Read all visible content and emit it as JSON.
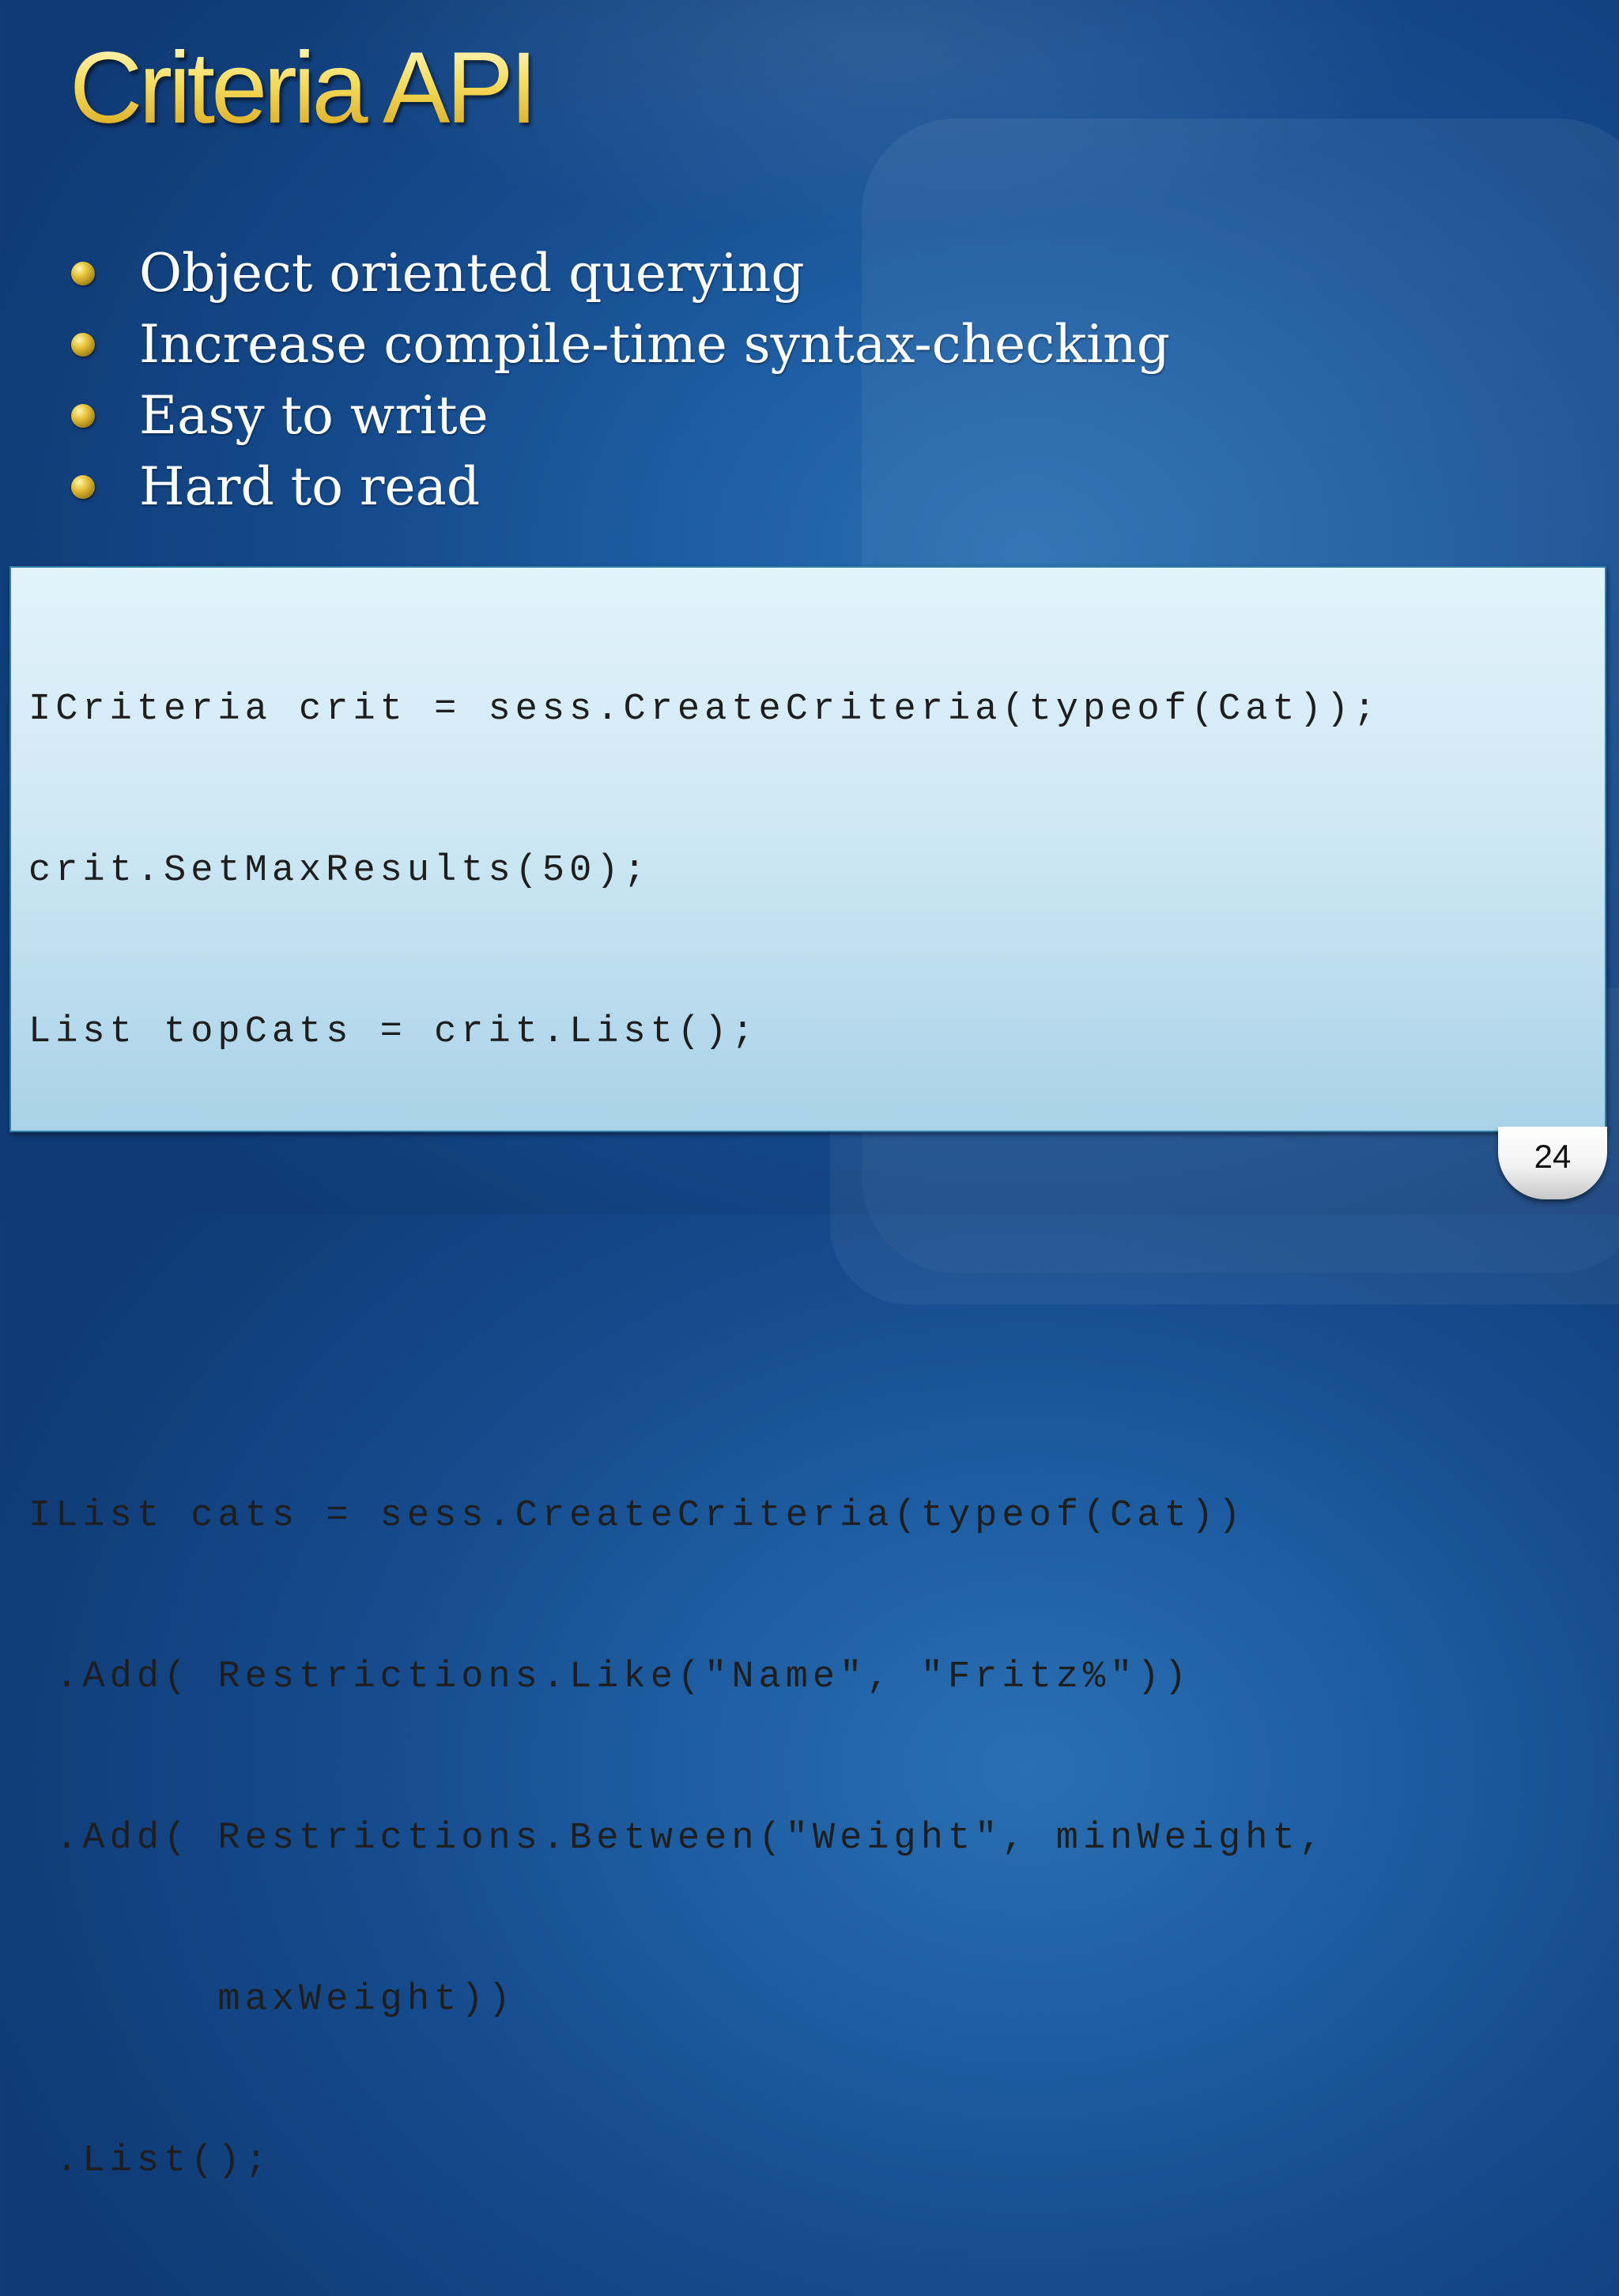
{
  "slide": {
    "title": "Criteria API",
    "bullets": [
      "Object oriented querying",
      "Increase compile-time syntax-checking",
      "Easy to write",
      "Hard to read"
    ],
    "code_lines": [
      "ICriteria crit = sess.CreateCriteria(typeof(Cat));",
      "crit.SetMaxResults(50);",
      "List topCats = crit.List();",
      "",
      "",
      "IList cats = sess.CreateCriteria(typeof(Cat))",
      " .Add( Restrictions.Like(\"Name\", \"Fritz%\"))",
      " .Add( Restrictions.Between(\"Weight\", minWeight,",
      "       maxWeight))",
      " .List();"
    ],
    "page_number": "24",
    "colors": {
      "background": "#1a559a",
      "title_gold": "#f4d44c",
      "code_box": "#cfe8f4",
      "code_border": "#2f7fa8"
    }
  }
}
